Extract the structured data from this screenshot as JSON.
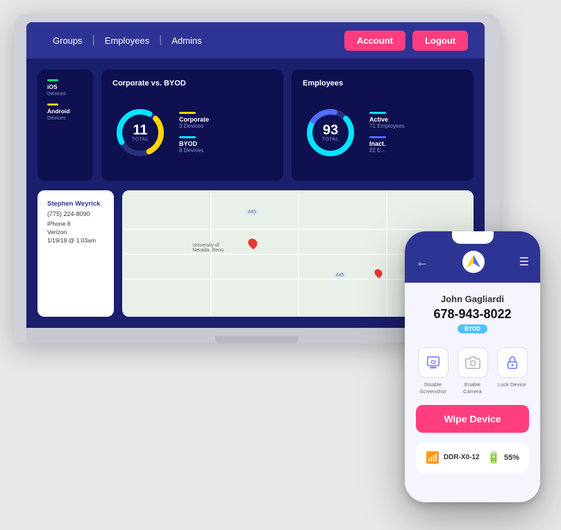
{
  "navbar": {
    "links": [
      "Groups",
      "Employees",
      "Admins"
    ],
    "account_label": "Account",
    "logout_label": "Logout"
  },
  "cards": {
    "partial": {
      "item1_label": "iOS",
      "item1_sub": "Devices",
      "item2_label": "Android",
      "item2_sub": "Devices"
    },
    "corporate_byod": {
      "title": "Corporate vs. BYOD",
      "total": "11",
      "total_label": "TOTAL",
      "corporate_label": "Corporate",
      "corporate_count": "3 Devices",
      "byod_label": "BYOD",
      "byod_count": "8 Devices"
    },
    "employees": {
      "title": "Employees",
      "total": "93",
      "total_label": "TOTAL",
      "active_label": "Active",
      "active_count": "71 Employees",
      "inactive_label": "Inact.",
      "inactive_count": "22 E..."
    }
  },
  "info_panel": {
    "name": "Stephen Weyrick",
    "phone": "(775) 224-8090",
    "device": "iPhone 8",
    "carrier": "Verizon",
    "date": "1/19/18 @ 1:03am"
  },
  "map": {
    "label1": "University of\nNevada, Reno",
    "label2": "445",
    "label3": "445"
  },
  "phone": {
    "user_name": "John Gagliardi",
    "phone_number": "678-943-8022",
    "badge": "BYOD",
    "action1_label": "Disable\nScreenshot",
    "action2_label": "Enable\nCamera",
    "action3_label": "Lock\nDevice",
    "wipe_label": "Wipe Device",
    "wifi_name": "DDR-X0-12",
    "battery_pct": "55%"
  }
}
